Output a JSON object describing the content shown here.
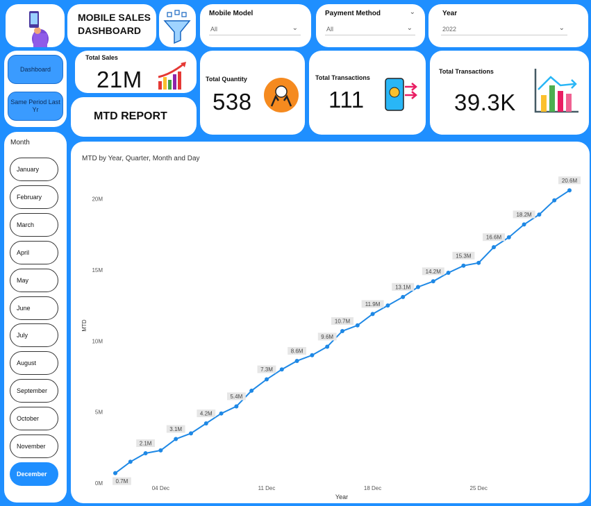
{
  "header": {
    "title": "MOBILE SALES\nDASHBOARD",
    "person_icon": "person-phone-icon",
    "filter_icon": "funnel-filter-icon"
  },
  "slicers": {
    "model": {
      "label": "Mobile Model",
      "value": "All"
    },
    "payment": {
      "label": "Payment Method",
      "value": "All"
    },
    "year": {
      "label": "Year",
      "value": "2022"
    }
  },
  "nav": {
    "dashboard_label": "Dashboard",
    "same_period_label": "Same Period Last Yr"
  },
  "kpis": {
    "total_sales": {
      "label": "Total Sales",
      "value": "21M",
      "icon": "growth-bar-icon"
    },
    "total_quantity": {
      "label": "Total Quantity",
      "value": "538",
      "icon": "hands-coin-icon"
    },
    "total_transactions_count": {
      "label": "Total Transactions",
      "value": "111",
      "icon": "phone-payment-icon"
    },
    "total_transactions_value": {
      "label": "Total Transactions",
      "value": "39.3K",
      "icon": "bar-chart-icon"
    }
  },
  "mtd_report_label": "MTD REPORT",
  "month_slicer": {
    "title": "Month",
    "months": [
      "January",
      "February",
      "March",
      "April",
      "May",
      "June",
      "July",
      "August",
      "September",
      "October",
      "November",
      "December"
    ],
    "selected": "December"
  },
  "colors": {
    "accent": "#1f8fff",
    "line": "#1e88e5"
  },
  "chart_data": {
    "type": "line",
    "title": "MTD by Year, Quarter, Month and Day",
    "xlabel": "Year",
    "ylabel": "MTD",
    "x_ticks": [
      "04 Dec",
      "11 Dec",
      "18 Dec",
      "25 Dec"
    ],
    "x_tick_days": [
      4,
      11,
      18,
      25
    ],
    "y_ticks": [
      "0M",
      "5M",
      "10M",
      "15M",
      "20M"
    ],
    "y_tick_values": [
      0,
      5,
      10,
      15,
      20
    ],
    "ylim": [
      0,
      21.2
    ],
    "xlim": [
      0.45,
      31.55
    ],
    "grid": false,
    "series": [
      {
        "x": [
          1,
          2,
          3,
          4,
          5,
          6,
          7,
          8,
          9,
          10,
          11,
          12,
          13,
          14,
          15,
          16,
          17,
          18,
          19,
          20,
          21,
          22,
          23,
          24,
          25,
          26,
          27,
          28,
          29,
          30,
          31
        ],
        "values": [
          0.7,
          1.5,
          2.1,
          2.3,
          3.1,
          3.5,
          4.2,
          4.9,
          5.4,
          6.5,
          7.3,
          8.0,
          8.6,
          9.0,
          9.6,
          10.7,
          11.1,
          11.9,
          12.5,
          13.1,
          13.8,
          14.2,
          14.8,
          15.3,
          15.5,
          16.6,
          17.3,
          18.2,
          18.9,
          19.9,
          20.6
        ],
        "labels": {
          "1": "0.7M",
          "3": "2.1M",
          "5": "3.1M",
          "7": "4.2M",
          "9": "5.4M",
          "11": "7.3M",
          "13": "8.6M",
          "15": "9.6M",
          "16": "10.7M",
          "18": "11.9M",
          "20": "13.1M",
          "22": "14.2M",
          "24": "15.3M",
          "26": "16.6M",
          "28": "18.2M",
          "31": "20.6M"
        }
      }
    ]
  }
}
